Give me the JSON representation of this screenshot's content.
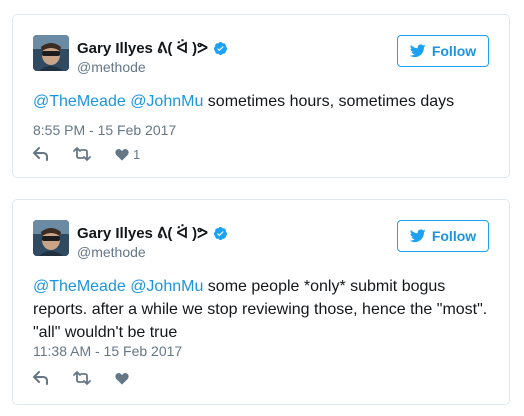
{
  "colors": {
    "accent": "#1da1f2",
    "link": "#1b95e0",
    "text": "#14171a",
    "muted": "#657786",
    "border": "#e1e8ed"
  },
  "icons": {
    "verified": "verified-badge-icon",
    "follow": "twitter-bird-icon",
    "reply": "reply-icon",
    "retweet": "retweet-icon",
    "like": "heart-icon"
  },
  "tweets": [
    {
      "author": {
        "name": "Gary Illyes ᕕ( ᐛ )ᕗ",
        "handle": "@methode",
        "verified": true
      },
      "follow_label": "Follow",
      "mention_1": "@TheMeade",
      "mention_2": "@JohnMu",
      "body": " sometimes hours, sometimes days",
      "timestamp": "8:55 PM - 15 Feb 2017",
      "like_count": "1"
    },
    {
      "author": {
        "name": "Gary Illyes ᕕ( ᐛ )ᕗ",
        "handle": "@methode",
        "verified": true
      },
      "follow_label": "Follow",
      "mention_1": "@TheMeade",
      "mention_2": "@JohnMu",
      "body": " some people *only* submit bogus reports. after a while we stop reviewing those, hence the \"most\". \"all\" wouldn't be true",
      "timestamp": "11:38 AM - 15 Feb 2017",
      "like_count": ""
    }
  ]
}
